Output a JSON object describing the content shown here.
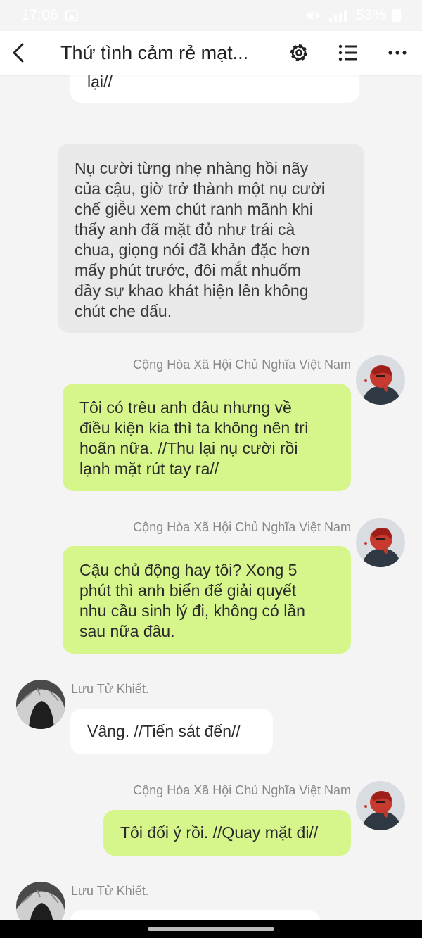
{
  "status_bar": {
    "time": "17:06",
    "battery": "53%",
    "icons": [
      "gallery-icon",
      "mute-icon",
      "signal-icon",
      "battery-icon"
    ]
  },
  "header": {
    "title": "Thứ tình cảm rẻ mạt...",
    "icons": [
      "back-arrow-icon",
      "gear-icon",
      "list-icon",
      "more-icon"
    ]
  },
  "messages": [
    {
      "type": "received-partial",
      "lines": [
        "lại//"
      ]
    },
    {
      "type": "narration",
      "lines": [
        "Nụ cười từng nhẹ nhàng hồi nãy",
        "của cậu, giờ trở thành một nụ cười",
        "chế giễu xem chút ranh mãnh khi",
        "thấy anh đã mặt đỏ như trái cà",
        "chua, giọng nói đã khản đặc hơn",
        "mấy phút trước, đôi mắt nhuốm",
        "đầy sự khao khát hiện lên không",
        "chút che dấu."
      ]
    },
    {
      "type": "sent",
      "sender": "Cộng Hòa Xã Hội Chủ Nghĩa Việt Nam",
      "lines": [
        "Tôi có trêu anh đâu nhưng về",
        "điều kiện kia thì ta không nên trì",
        "hoãn nữa. //Thu lại nụ cười rồi",
        "lạnh mặt rút tay ra//"
      ]
    },
    {
      "type": "sent",
      "sender": "Cộng Hòa Xã Hội Chủ Nghĩa Việt Nam",
      "lines": [
        "Cậu chủ động hay tôi? Xong 5",
        "phút thì anh biến để giải quyết",
        "nhu cầu sinh lý đi, không có lần",
        "sau nữa đâu."
      ]
    },
    {
      "type": "received",
      "sender": "Lưu Tử Khiết.",
      "lines": [
        "Vâng. //Tiến sát đến//"
      ]
    },
    {
      "type": "sent",
      "sender": "Cộng Hòa Xã Hội Chủ Nghĩa Việt Nam",
      "lines": [
        "Tôi đổi ý rồi. //Quay mặt đi//"
      ]
    },
    {
      "type": "received",
      "sender": "Lưu Tử Khiết.",
      "lines": []
    }
  ],
  "colors": {
    "sent_bubble": "#d6f58b",
    "received_bubble": "#ffffff",
    "narration_bubble": "#e9e9e9",
    "background": "#f4f4f4"
  }
}
